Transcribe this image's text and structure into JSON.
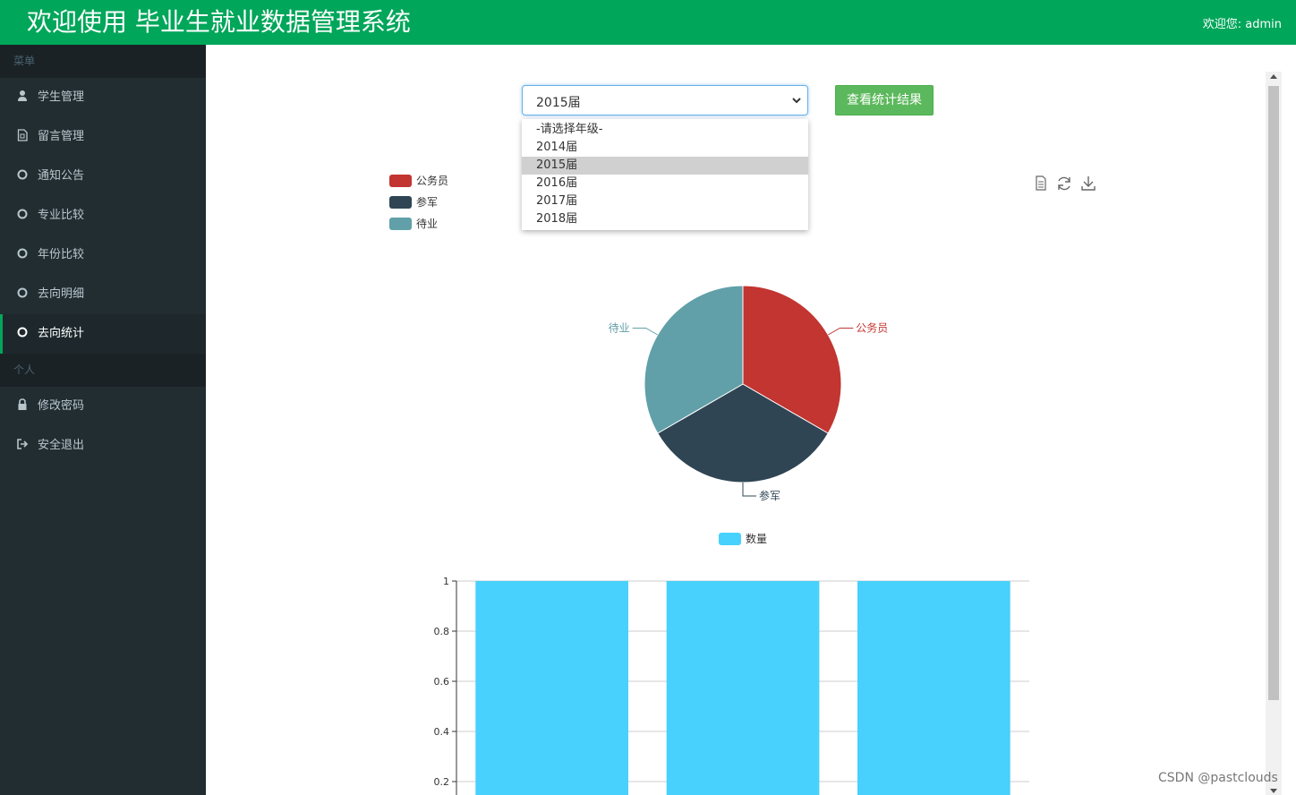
{
  "header": {
    "title": "欢迎使用 毕业生就业数据管理系统",
    "welcome": "欢迎您:  admin"
  },
  "sidebar": {
    "menu_header": "菜单",
    "items": [
      {
        "label": "学生管理",
        "icon": "user-icon"
      },
      {
        "label": "留言管理",
        "icon": "file-icon"
      },
      {
        "label": "通知公告",
        "icon": "circle-icon"
      },
      {
        "label": "专业比较",
        "icon": "circle-icon"
      },
      {
        "label": "年份比较",
        "icon": "circle-icon"
      },
      {
        "label": "去向明细",
        "icon": "circle-icon"
      },
      {
        "label": "去向统计",
        "icon": "circle-icon",
        "active": true
      }
    ],
    "personal_header": "个人",
    "personal_items": [
      {
        "label": "修改密码",
        "icon": "lock-icon"
      },
      {
        "label": "安全退出",
        "icon": "sign-out-icon"
      }
    ]
  },
  "filter": {
    "selected": "2015届",
    "options": [
      "-请选择年级-",
      "2014届",
      "2015届",
      "2016届",
      "2017届",
      "2018届"
    ],
    "button_label": "查看统计结果"
  },
  "toolbox": [
    "data-view-icon",
    "restore-icon",
    "save-image-icon"
  ],
  "colors": {
    "header": "#00a65a",
    "sidebar": "#222d32",
    "bar": "#48d1fc"
  },
  "chart_data": [
    {
      "type": "pie",
      "legend": [
        "公务员",
        "参军",
        "待业"
      ],
      "legend_position": "top-left",
      "slices": [
        {
          "name": "公务员",
          "value": 1,
          "color": "#c23531"
        },
        {
          "name": "参军",
          "value": 1,
          "color": "#2f4554"
        },
        {
          "name": "待业",
          "value": 1,
          "color": "#61a0a8"
        }
      ]
    },
    {
      "type": "bar",
      "series": [
        {
          "name": "数量",
          "values": [
            1,
            1,
            1
          ],
          "color": "#48d1fc"
        }
      ],
      "legend_position": "top",
      "yticks": [
        "0.2",
        "0.4",
        "0.6",
        "0.8",
        "1"
      ],
      "ylim": [
        0,
        1
      ],
      "grid": true
    }
  ],
  "watermark": "CSDN @pastclouds"
}
